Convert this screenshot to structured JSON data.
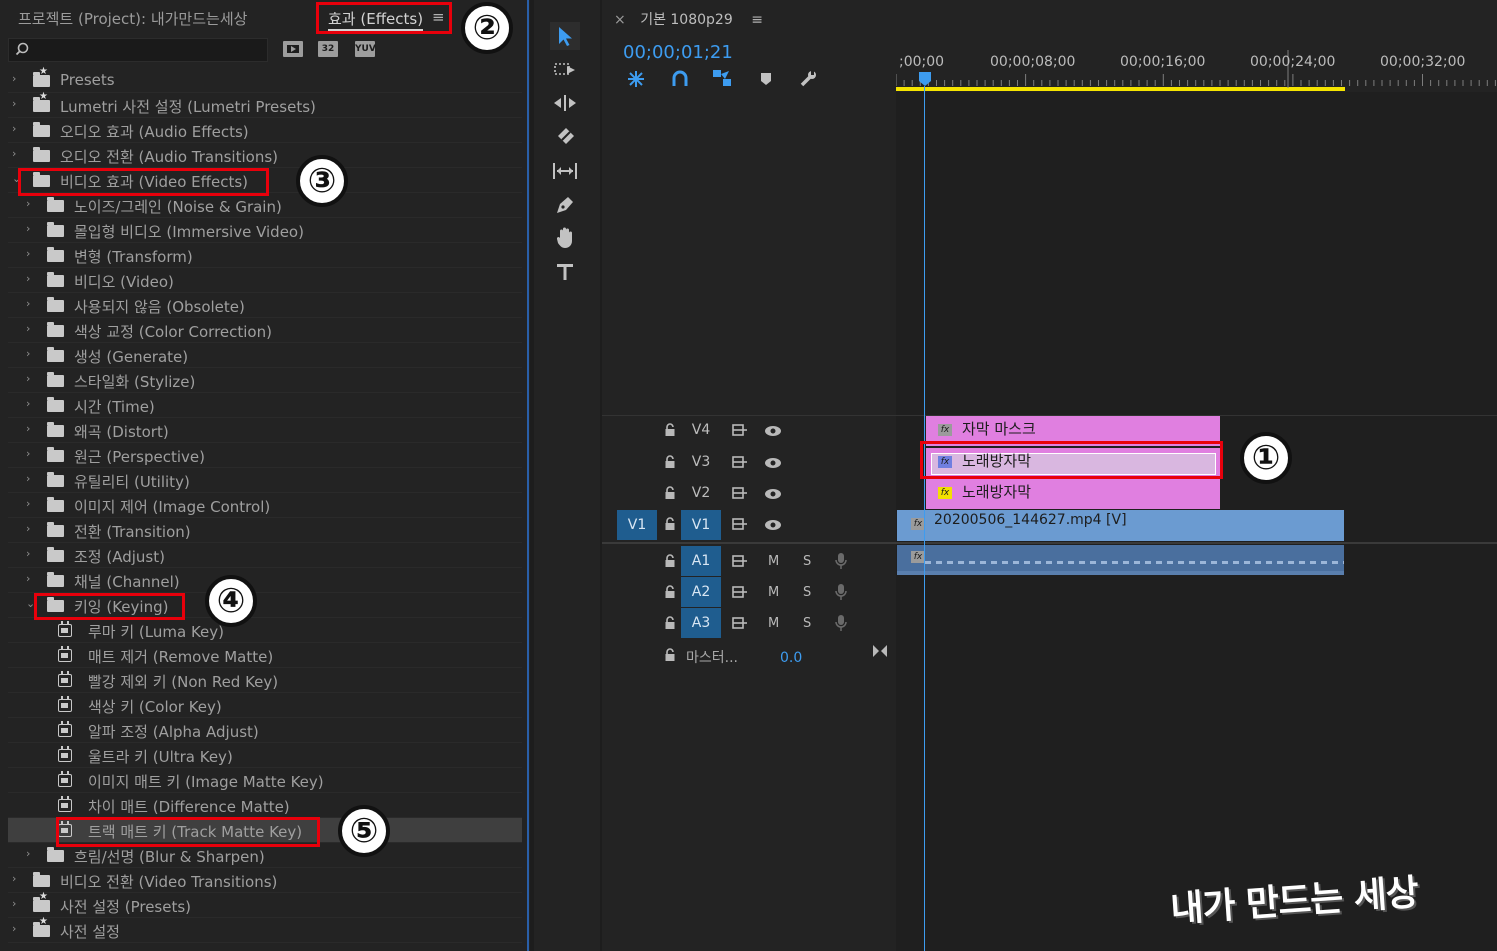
{
  "effects_panel": {
    "project_tab": "프로젝트 (Project): 내가만드는세상",
    "effects_tab": "효과 (Effects)",
    "menu_glyph": "≡",
    "badges": [
      "32",
      "YUV"
    ],
    "tree": [
      {
        "label": "Presets",
        "level": 0,
        "kind": "star-folder",
        "chev": "›"
      },
      {
        "label": "Lumetri 사전 설정 (Lumetri Presets)",
        "level": 0,
        "kind": "star-folder",
        "chev": "›"
      },
      {
        "label": "오디오 효과 (Audio Effects)",
        "level": 0,
        "kind": "folder",
        "chev": "›"
      },
      {
        "label": "오디오 전환 (Audio Transitions)",
        "level": 0,
        "kind": "folder",
        "chev": "›"
      },
      {
        "label": "비디오 효과 (Video Effects)",
        "level": 0,
        "kind": "folder",
        "chev": "⌄"
      },
      {
        "label": "노이즈/그레인 (Noise & Grain)",
        "level": 1,
        "kind": "folder",
        "chev": "›"
      },
      {
        "label": "몰입형 비디오 (Immersive Video)",
        "level": 1,
        "kind": "folder",
        "chev": "›"
      },
      {
        "label": "변형 (Transform)",
        "level": 1,
        "kind": "folder",
        "chev": "›"
      },
      {
        "label": "비디오 (Video)",
        "level": 1,
        "kind": "folder",
        "chev": "›"
      },
      {
        "label": "사용되지 않음 (Obsolete)",
        "level": 1,
        "kind": "folder",
        "chev": "›"
      },
      {
        "label": "색상 교정 (Color Correction)",
        "level": 1,
        "kind": "folder",
        "chev": "›"
      },
      {
        "label": "생성 (Generate)",
        "level": 1,
        "kind": "folder",
        "chev": "›"
      },
      {
        "label": "스타일화 (Stylize)",
        "level": 1,
        "kind": "folder",
        "chev": "›"
      },
      {
        "label": "시간 (Time)",
        "level": 1,
        "kind": "folder",
        "chev": "›"
      },
      {
        "label": "왜곡 (Distort)",
        "level": 1,
        "kind": "folder",
        "chev": "›"
      },
      {
        "label": "원근 (Perspective)",
        "level": 1,
        "kind": "folder",
        "chev": "›"
      },
      {
        "label": "유틸리티 (Utility)",
        "level": 1,
        "kind": "folder",
        "chev": "›"
      },
      {
        "label": "이미지 제어 (Image Control)",
        "level": 1,
        "kind": "folder",
        "chev": "›"
      },
      {
        "label": "전환 (Transition)",
        "level": 1,
        "kind": "folder",
        "chev": "›"
      },
      {
        "label": "조정 (Adjust)",
        "level": 1,
        "kind": "folder",
        "chev": "›"
      },
      {
        "label": "채널 (Channel)",
        "level": 1,
        "kind": "folder",
        "chev": "›"
      },
      {
        "label": "키잉 (Keying)",
        "level": 1,
        "kind": "folder",
        "chev": "⌄"
      },
      {
        "label": "루마 키 (Luma Key)",
        "level": 2,
        "kind": "effect",
        "chev": ""
      },
      {
        "label": "매트 제거 (Remove Matte)",
        "level": 2,
        "kind": "effect",
        "chev": ""
      },
      {
        "label": "빨강 제외 키 (Non Red Key)",
        "level": 2,
        "kind": "effect",
        "chev": ""
      },
      {
        "label": "색상 키 (Color Key)",
        "level": 2,
        "kind": "effect",
        "chev": ""
      },
      {
        "label": "알파 조정 (Alpha Adjust)",
        "level": 2,
        "kind": "effect",
        "chev": ""
      },
      {
        "label": "울트라 키 (Ultra Key)",
        "level": 2,
        "kind": "effect",
        "chev": ""
      },
      {
        "label": "이미지 매트 키 (Image Matte Key)",
        "level": 2,
        "kind": "effect",
        "chev": ""
      },
      {
        "label": "차이 매트 (Difference Matte)",
        "level": 2,
        "kind": "effect",
        "chev": ""
      },
      {
        "label": "트랙 매트 키 (Track Matte Key)",
        "level": 2,
        "kind": "effect",
        "chev": "",
        "selected": true
      },
      {
        "label": "흐림/선명 (Blur & Sharpen)",
        "level": 1,
        "kind": "folder",
        "chev": "›"
      },
      {
        "label": "비디오 전환 (Video Transitions)",
        "level": 0,
        "kind": "folder",
        "chev": "›"
      },
      {
        "label": "사전 설정 (Presets)",
        "level": 0,
        "kind": "star-folder",
        "chev": "›"
      },
      {
        "label": "사전 설정",
        "level": 0,
        "kind": "star-folder",
        "chev": "›"
      }
    ]
  },
  "annotations": [
    "①",
    "②",
    "③",
    "④",
    "⑤"
  ],
  "timeline": {
    "sequence_close": "×",
    "sequence_tab": "기본 1080p29",
    "menu_glyph": "≡",
    "playhead_timecode": "00;00;01;21",
    "ruler_labels": [
      ";00;00",
      "00;00;08;00",
      "00;00;16;00",
      "00;00;24;00",
      "00;00;32;00"
    ],
    "video_tracks": [
      {
        "name": "V4",
        "target": false
      },
      {
        "name": "V3",
        "target": false
      },
      {
        "name": "V2",
        "target": false
      },
      {
        "name": "V1",
        "target": true,
        "source": "V1"
      }
    ],
    "audio_tracks": [
      {
        "name": "A1",
        "m": "M",
        "s": "S"
      },
      {
        "name": "A2",
        "m": "M",
        "s": "S"
      },
      {
        "name": "A3",
        "m": "M",
        "s": "S"
      }
    ],
    "master": {
      "label": "마스터...",
      "value": "0.0"
    },
    "clips": {
      "v4": {
        "label": "자막 마스크",
        "fx": "fx"
      },
      "v3": {
        "label": "노래방자막",
        "fx": "fx"
      },
      "v2": {
        "label": "노래방자막",
        "fx": "fx"
      },
      "v1": {
        "label": "20200506_144627.mp4 [V]",
        "fx": "fx"
      },
      "a1": {
        "fx": "fx"
      }
    }
  },
  "watermark": "내가 만드는 세상",
  "colors": {
    "accent_blue": "#3d9cf0",
    "annotation_red": "#e8000b",
    "title_clip_pink": "#e07fe0",
    "video_clip_blue": "#6b9bd1",
    "audio_clip_blue": "#4a6f9e",
    "work_area_yellow": "#f5e400"
  }
}
